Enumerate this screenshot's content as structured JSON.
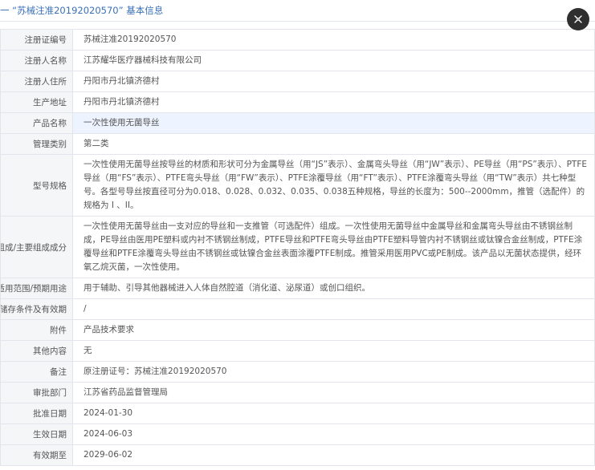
{
  "header": {
    "title": "一 “苏械注准20192020570” 基本信息"
  },
  "rows": [
    {
      "label": "注册证编号",
      "value": "苏械注准20192020570"
    },
    {
      "label": "注册人名称",
      "value": "江苏耀华医疗器械科技有限公司"
    },
    {
      "label": "注册人住所",
      "value": "丹阳市丹北镇济德村"
    },
    {
      "label": "生产地址",
      "value": "丹阳市丹北镇济德村"
    },
    {
      "label": "产品名称",
      "value": "一次性使用无菌导丝"
    },
    {
      "label": "管理类别",
      "value": "第二类"
    },
    {
      "label": "型号规格",
      "value": "一次性使用无菌导丝按导丝的材质和形状可分为金属导丝（用“JS”表示）、金属弯头导丝（用“JW”表示）、PE导丝（用“PS”表示）、PTFE导丝（用“FS”表示）、PTFE弯头导丝（用“FW”表示）、PTFE涂覆导丝（用“FT”表示）、PTFE涂覆弯头导丝（用“TW”表示）共七种型号。各型号导丝按直径可分为0.018、0.028、0.032、0.035、0.038五种规格，导丝的长度为：500--2000mm，推管（选配件）的规格为 I 、II。"
    },
    {
      "label": "结构及组成/主要组成成分",
      "value": "一次性使用无菌导丝由一支对应的导丝和一支推管（可选配件）组成。一次性使用无菌导丝中金属导丝和金属弯头导丝由不锈钢丝制成，PE导丝由医用PE塑料或内衬不锈钢丝制成，PTFE导丝和PTFE弯头导丝由PTFE塑料导管内衬不锈钢丝或钛镍合金丝制成，PTFE涂覆导丝和PTFE涂覆弯头导丝由不锈钢丝或钛镍合金丝表面涂覆PTFE制成。推管采用医用PVC或PE制成。该产品以无菌状态提供，经环氧乙烷灭菌，一次性使用。"
    },
    {
      "label": "适用范围/预期用途",
      "value": "用于辅助、引导其他器械进入人体自然腔道（消化道、泌尿道）或创口组织。"
    },
    {
      "label": "产品储存条件及有效期",
      "value": "/"
    },
    {
      "label": "附件",
      "value": "产品技术要求"
    },
    {
      "label": "其他内容",
      "value": "无"
    },
    {
      "label": "备注",
      "value": "原注册证号：苏械注准20192020570"
    },
    {
      "label": "审批部门",
      "value": "江苏省药品监督管理局"
    },
    {
      "label": "批准日期",
      "value": "2024-01-30"
    },
    {
      "label": "生效日期",
      "value": "2024-06-03"
    },
    {
      "label": "有效期至",
      "value": "2029-06-02"
    }
  ],
  "close_button": {
    "icon": "close-icon"
  }
}
